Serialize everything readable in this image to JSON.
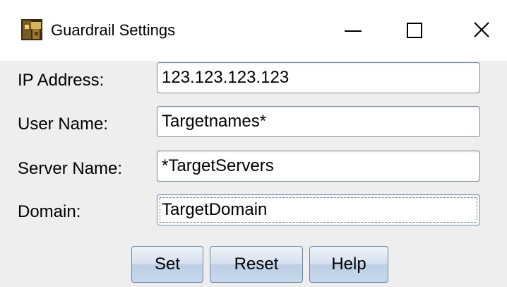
{
  "window": {
    "title": "Guardrail Settings",
    "app_icon": "guardrail-app-icon",
    "controls": {
      "minimize": "minimize-icon",
      "maximize": "maximize-icon",
      "close": "close-icon"
    }
  },
  "form": {
    "fields": [
      {
        "label": "IP Address:",
        "value": "123.123.123.123"
      },
      {
        "label": "User Name:",
        "value": "Targetnames*"
      },
      {
        "label": "Server Name:",
        "value": "*TargetServers"
      },
      {
        "label": "Domain:",
        "value": "TargetDomain",
        "focused": true
      }
    ]
  },
  "buttons": {
    "set": "Set",
    "reset": "Reset",
    "help": "Help"
  },
  "colors": {
    "window_bg": "#eeeeee",
    "titlebar_bg": "#ffffff",
    "button_gradient_top": "#eef3f9",
    "button_gradient_bottom": "#c8d9ec",
    "button_border": "#6b87a8"
  }
}
